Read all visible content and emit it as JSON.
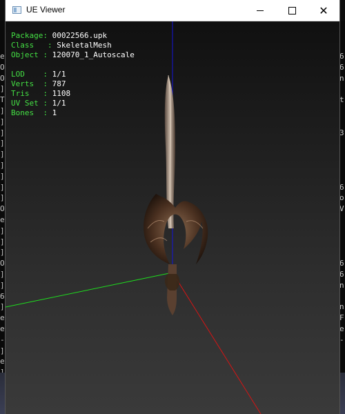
{
  "window": {
    "title": "UE Viewer"
  },
  "info": {
    "package_label": "Package",
    "package_value": "00022566.upk",
    "class_label": "Class",
    "class_value": "SkeletalMesh",
    "object_label": "Object",
    "object_value": "120070_1_Autoscale",
    "lod_label": "LOD",
    "lod_value": "1/1",
    "verts_label": "Verts",
    "verts_value": "787",
    "tris_label": "Tris",
    "tris_value": "1108",
    "uvset_label": "UV Set",
    "uvset_value": "1/1",
    "bones_label": "Bones",
    "bones_value": "1"
  },
  "background_console": {
    "left_chars": [
      "e",
      "O",
      "O",
      "]",
      "T",
      "]",
      "]",
      "]",
      "]",
      "]",
      "]",
      "]",
      "]",
      "]",
      "O",
      "e",
      "]",
      "]",
      "]",
      "O",
      "]",
      "]",
      "6",
      "]",
      "e",
      "e",
      "-",
      "]",
      "e",
      "]"
    ],
    "right_chars": [
      "6",
      "6",
      "n",
      "",
      "t",
      "",
      "",
      "3",
      "",
      "",
      "",
      "",
      "6",
      "o",
      "V",
      "",
      "",
      "",
      "",
      "6",
      "6",
      "n",
      "",
      "n",
      "F",
      "e",
      "-",
      "",
      ""
    ]
  },
  "axes_colors": {
    "x": "#e01010",
    "y": "#10e010",
    "z": "#1010e0"
  }
}
